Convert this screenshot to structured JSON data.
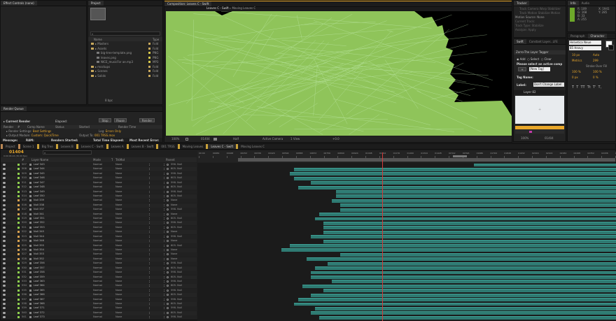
{
  "effect_controls": {
    "tab": "Effect Controls (none)"
  },
  "project": {
    "tab": "Project",
    "columns": [
      "Name",
      "Type"
    ],
    "items": [
      {
        "name": "Masters",
        "type": "Fold",
        "kind": "folder",
        "indent": 0
      },
      {
        "name": "Assets",
        "type": "Fold",
        "kind": "folder",
        "indent": 0
      },
      {
        "name": "big-tree-template.png",
        "type": "PNG",
        "kind": "file",
        "indent": 1
      },
      {
        "name": "leaves.png",
        "type": "PNG",
        "kind": "file",
        "indent": 1
      },
      {
        "name": "NICE_musicFor ae.mp3",
        "type": "MP3",
        "kind": "file",
        "indent": 1
      },
      {
        "name": "mockups",
        "type": "Fold",
        "kind": "folder",
        "indent": 0
      },
      {
        "name": "Scenes",
        "type": "Fold",
        "kind": "folder",
        "indent": 0
      },
      {
        "name": "Solids",
        "type": "Fold",
        "kind": "folder",
        "indent": 0
      }
    ],
    "footer": "8 bpc"
  },
  "render_queue": {
    "tab": "Render Queue",
    "current_render": "Current Render",
    "elapsed_label": "Elapsed:",
    "buttons": [
      "Stop",
      "Pause",
      "Render"
    ],
    "headers": [
      "Render",
      "#",
      "Comp Name",
      "Status",
      "Started",
      "Render Time"
    ],
    "render_settings_label": "Render Settings:",
    "render_settings_value": "Best Settings",
    "output_module_label": "Output Module:",
    "output_module_value": "Custom: QuickTime",
    "log_label": "Log:",
    "log_value": "Errors Only",
    "output_to_label": "Output To:",
    "output_to_value": "001 TRSS.mov",
    "message_label": "Message:",
    "ram_label": "RAM:",
    "renders_started_label": "Renders Started:",
    "total_time_label": "Total Time Elapsed:",
    "recent_error_label": "Most Recent Error:"
  },
  "composition": {
    "title": "Composition: Leaves C - Swift",
    "tabs": [
      "Leaves C - Swift",
      "Moving Leaves C"
    ],
    "footer": {
      "zoom": "100%",
      "timecode": "01404",
      "resolution": "Half",
      "camera": "Active Camera",
      "views": "1 View",
      "exposure": "+0.0"
    }
  },
  "tracker": {
    "tabs": [
      "Tracker",
      "Info",
      "Audio"
    ],
    "rows": [
      "Track Camera",
      "Warp Stabilizer",
      "Track Motion",
      "Stabilize Motion",
      "Motion Source:",
      "Current Track:",
      "Track Type:",
      "Analyze:",
      "Apply"
    ],
    "motion_source_value": "None",
    "stabilize_value": "Stabilize",
    "info_lines": [
      "R: 109",
      "G: 168",
      "B: 33",
      "A: 255"
    ],
    "coords": [
      "X: 1941",
      "Y: 285"
    ]
  },
  "zorro": {
    "tabs": [
      "Swift",
      "Constant Layer...LFE"
    ],
    "title": "Zorro-The Layer Tagger",
    "add_label": "Add",
    "select_label": "Select",
    "clear_label": "Clear",
    "select_prompt": "Please select an active comp",
    "tag_value": "[New Tag]",
    "tag_name_label": "Tag Name:",
    "label_label": "Label:",
    "label_value": "Don't Change Label",
    "preview_tab": "Layer 82",
    "preview_zoom": "100%",
    "preview_time": "01404"
  },
  "character": {
    "tabs": [
      "Paragraph",
      "Character"
    ],
    "font": "Helvetica Neue",
    "style": "85 Heavy",
    "sizes": [
      "10 px",
      "Auto",
      "Metrics",
      "299"
    ],
    "stroke": "Stroke Over Fill",
    "scales": [
      "100 %",
      "100 %",
      "0 px",
      "0 %"
    ],
    "styles": [
      "T",
      "T",
      "TT",
      "Tt",
      "T'",
      "T,"
    ]
  },
  "timeline": {
    "tabs": [
      "Project",
      "Scene 1",
      "Big Tree",
      "Leaves B",
      "Leaves C - Swift",
      "Leaves A",
      "Leaves B - Swift",
      "001 TRSS",
      "Moving Leaves",
      "Leaves C - Swift",
      "Moving Leaves C"
    ],
    "active_tab": "Leaves C - Swift",
    "timecode": "01404",
    "fps": "0:00:46:24 (30.00 fps)",
    "search_placeholder": "⌕",
    "col_headers": [
      "#",
      "Layer Name",
      "Mode",
      "T",
      "TrkMat",
      "Parent"
    ],
    "ruler": [
      "00:00",
      "00084",
      "00168",
      "00252",
      "00336",
      "00420",
      "00504",
      "00588",
      "00672",
      "00756",
      "00840",
      "00924",
      "01008",
      "01092",
      "01176",
      "01260",
      "01344",
      "01428",
      "01512",
      "01596",
      "01680",
      "01764",
      "01848",
      "01932",
      "02016",
      "02100",
      "02184",
      "02268",
      "02352",
      "02436",
      "02520"
    ],
    "playhead": 0.44,
    "layers": [
      {
        "num": "507",
        "name": "Leaf 343",
        "mode": "Normal",
        "trk": "None",
        "parent": "596. Null",
        "start": 0.66
      },
      {
        "num": "508",
        "name": "Leaf 344",
        "mode": "Normal",
        "trk": "None",
        "parent": "605. Null",
        "start": 0.23
      },
      {
        "num": "509",
        "name": "Leaf 345",
        "mode": "Normal",
        "trk": "None",
        "parent": "598. Null",
        "start": 0.22
      },
      {
        "num": "510",
        "name": "Leaf 346",
        "mode": "Normal",
        "trk": "None",
        "parent": "603. Null",
        "start": 0.23
      },
      {
        "num": "511",
        "name": "Leaf 347",
        "mode": "Normal",
        "trk": "None",
        "parent": "598. Null",
        "start": 0.27
      },
      {
        "num": "512",
        "name": "Leaf 348",
        "mode": "Normal",
        "trk": "None",
        "parent": "605. Null",
        "start": 0.24
      },
      {
        "num": "513",
        "name": "Leaf 349",
        "mode": "Normal",
        "trk": "None",
        "parent": "598. Null",
        "start": 0.33
      },
      {
        "num": "514",
        "name": "Leaf 350",
        "mode": "Normal",
        "trk": "None",
        "parent": "605. Null",
        "start": 0.33
      },
      {
        "num": "515",
        "name": "Null 339",
        "mode": "Normal",
        "trk": "None",
        "parent": "None",
        "start": 0.32
      },
      {
        "num": "516",
        "name": "Null 338",
        "mode": "Normal",
        "trk": "None",
        "parent": "None",
        "start": 0.34
      },
      {
        "num": "517",
        "name": "Null 337",
        "mode": "Normal",
        "trk": "None",
        "parent": "598. Null",
        "start": 0.34
      },
      {
        "num": "518",
        "name": "Null 341",
        "mode": "Normal",
        "trk": "None",
        "parent": "None",
        "start": 0.29
      },
      {
        "num": "519",
        "name": "Leaf 351",
        "mode": "Normal",
        "trk": "None",
        "parent": "605. Null",
        "start": 0.28
      },
      {
        "num": "520",
        "name": "Leaf 352",
        "mode": "Normal",
        "trk": "None",
        "parent": "598. Null",
        "start": 0.3
      },
      {
        "num": "521",
        "name": "Leaf 353",
        "mode": "Normal",
        "trk": "None",
        "parent": "605. Null",
        "start": 0.3
      },
      {
        "num": "522",
        "name": "Null 345",
        "mode": "Normal",
        "trk": "None",
        "parent": "None",
        "start": 0.3
      },
      {
        "num": "523",
        "name": "Null 344",
        "mode": "Normal",
        "trk": "None",
        "parent": "598. Null",
        "start": 0.27
      },
      {
        "num": "524",
        "name": "Null 346",
        "mode": "Normal",
        "trk": "None",
        "parent": "None",
        "start": 0.3
      },
      {
        "num": "525",
        "name": "Null 355",
        "mode": "Normal",
        "trk": "None",
        "parent": "605. Null",
        "start": 0.22
      },
      {
        "num": "526",
        "name": "Null 354",
        "mode": "Normal",
        "trk": "None",
        "parent": "None",
        "start": 0.2
      },
      {
        "num": "527",
        "name": "Null 353",
        "mode": "Normal",
        "trk": "None",
        "parent": "None",
        "start": 0.34
      },
      {
        "num": "528",
        "name": "Null 352",
        "mode": "Normal",
        "trk": "None",
        "parent": "None",
        "start": 0.26
      },
      {
        "num": "529",
        "name": "Leaf 356",
        "mode": "Normal",
        "trk": "None",
        "parent": "598. Null",
        "start": 0.31
      },
      {
        "num": "530",
        "name": "Leaf 357",
        "mode": "Normal",
        "trk": "None",
        "parent": "605. Null",
        "start": 0.28
      },
      {
        "num": "531",
        "name": "Leaf 358",
        "mode": "Normal",
        "trk": "None",
        "parent": "598. Null",
        "start": 0.27
      },
      {
        "num": "532",
        "name": "Leaf 359",
        "mode": "Normal",
        "trk": "None",
        "parent": "605. Null",
        "start": 0.27
      },
      {
        "num": "533",
        "name": "Leaf 363",
        "mode": "Normal",
        "trk": "None",
        "parent": "598. Null",
        "start": 0.32
      },
      {
        "num": "534",
        "name": "Leaf 364",
        "mode": "Normal",
        "trk": "None",
        "parent": "605. Null",
        "start": 0.25
      },
      {
        "num": "535",
        "name": "Leaf 365",
        "mode": "Normal",
        "trk": "None",
        "parent": "598. Null",
        "start": 0.3
      },
      {
        "num": "536",
        "name": "Leaf 366",
        "mode": "Normal",
        "trk": "None",
        "parent": "605. Null",
        "start": 0.27
      },
      {
        "num": "537",
        "name": "Leaf 367",
        "mode": "Normal",
        "trk": "None",
        "parent": "598. Null",
        "start": 0.24
      },
      {
        "num": "538",
        "name": "Leaf 368",
        "mode": "Normal",
        "trk": "None",
        "parent": "605. Null",
        "start": 0.23
      },
      {
        "num": "539",
        "name": "Leaf 371",
        "mode": "Normal",
        "trk": "None",
        "parent": "598. Null",
        "start": 0.28
      },
      {
        "num": "540",
        "name": "Leaf 372",
        "mode": "Normal",
        "trk": "None",
        "parent": "605. Null",
        "start": 0.27
      },
      {
        "num": "541",
        "name": "Leaf 373",
        "mode": "Normal",
        "trk": "None",
        "parent": "598. Null",
        "start": 0.29
      }
    ]
  },
  "colors": {
    "accent": "#e8a72a",
    "bar": "#2e7a72",
    "bar_edge": "#3fa095",
    "comp_green": "#8fc45a",
    "playhead": "#d33b3b",
    "label_green": "#8fd14f"
  }
}
